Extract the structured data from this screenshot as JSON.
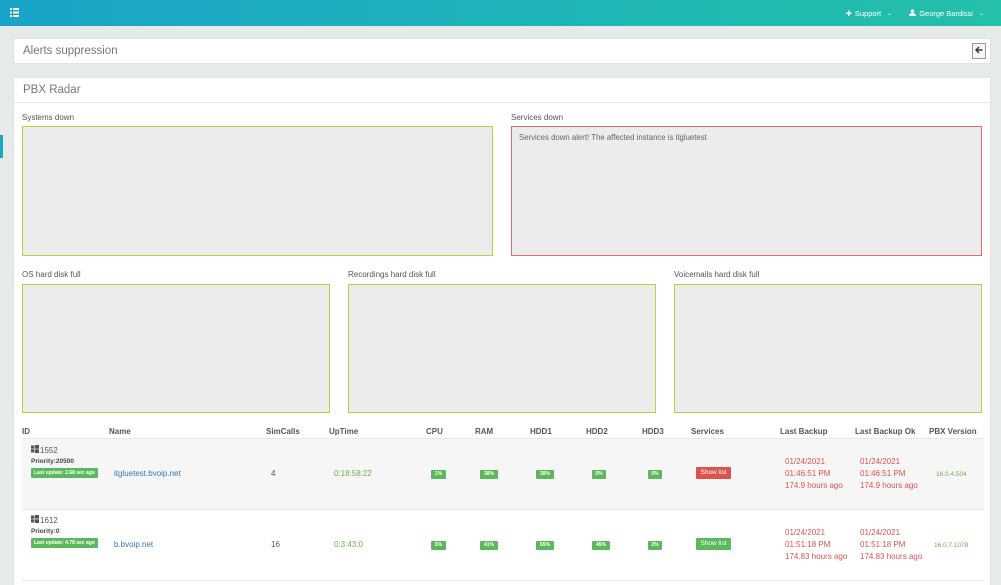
{
  "topbar": {
    "support_label": "Support",
    "user_name": "George Bardissi",
    "accent": "#1fb6b6"
  },
  "alerts_panel": {
    "title": "Alerts suppression"
  },
  "radar_panel": {
    "title": "PBX Radar",
    "boxes": {
      "systems_down": {
        "label": "Systems down",
        "text": ""
      },
      "services_down": {
        "label": "Services down",
        "text": "Services down alert! The affected instance is itgluetest"
      },
      "os_disk": {
        "label": "OS hard disk full",
        "text": ""
      },
      "recordings_disk": {
        "label": "Recordings hard disk full",
        "text": ""
      },
      "voicemails_disk": {
        "label": "Voicemails hard disk full",
        "text": ""
      }
    }
  },
  "table": {
    "headers": {
      "id": "ID",
      "name": "Name",
      "simcalls": "SimCalls",
      "uptime": "UpTime",
      "cpu": "CPU",
      "ram": "RAM",
      "hdd1": "HDD1",
      "hdd2": "HDD2",
      "hdd3": "HDD3",
      "services": "Services",
      "last_backup": "Last Backup",
      "last_backup_ok": "Last Backup Ok",
      "pbx_version": "PBX Version"
    },
    "rows": [
      {
        "id": "1552",
        "priority": "Priority:20500",
        "last_update": "Last update: 2.68 sec ago",
        "name": "itgluetest.bvoip.net",
        "simcalls": "4",
        "uptime": "0:18:58:22",
        "cpu": "1%",
        "ram": "38%",
        "hdd1": "39%",
        "hdd2": "0%",
        "hdd3": "0%",
        "services": "Show list",
        "services_status": "red",
        "last_backup": {
          "date": "01/24/2021",
          "time": "01:46:51 PM",
          "ago": "174.9 hours ago"
        },
        "last_backup_ok": {
          "date": "01/24/2021",
          "time": "01:46:51 PM",
          "ago": "174.9 hours ago"
        },
        "version": "16.0.4.504"
      },
      {
        "id": "1612",
        "priority": "Priority:0",
        "last_update": "Last update: 4.78 sec ago",
        "name": "b.bvoip.net",
        "simcalls": "16",
        "uptime": "0:3:43:0",
        "cpu": "5%",
        "ram": "41%",
        "hdd1": "65%",
        "hdd2": "45%",
        "hdd3": "2%",
        "services": "Show list",
        "services_status": "green",
        "last_backup": {
          "date": "01/24/2021",
          "time": "01:51:18 PM",
          "ago": "174.83 hours ago"
        },
        "last_backup_ok": {
          "date": "01/24/2021",
          "time": "01:51:18 PM",
          "ago": "174.83 hours ago"
        },
        "version": "16.0.7.1078"
      }
    ]
  }
}
